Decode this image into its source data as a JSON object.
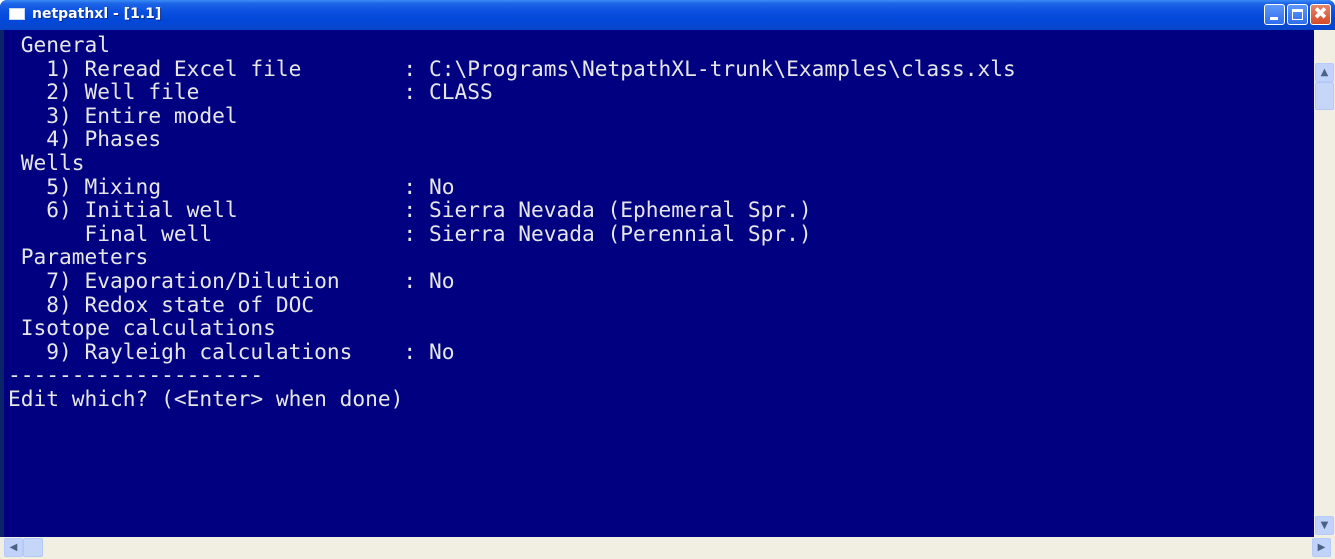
{
  "window": {
    "title": "netpathxl - [1.1]",
    "buttons": {
      "minimize": "minimize",
      "maximize": "maximize",
      "close": "✖"
    }
  },
  "console": {
    "lines": [
      " General",
      "   1) Reread Excel file        : C:\\Programs\\NetpathXL-trunk\\Examples\\class.xls",
      "   2) Well file                : CLASS",
      "   3) Entire model",
      "   4) Phases",
      " Wells",
      "   5) Mixing                   : No",
      "   6) Initial well             : Sierra Nevada (Ephemeral Spr.)",
      "      Final well               : Sierra Nevada (Perennial Spr.)",
      " Parameters",
      "   7) Evaporation/Dilution     : No",
      "   8) Redox state of DOC",
      " Isotope calculations",
      "   9) Rayleigh calculations    : No",
      "--------------------",
      "Edit which? (<Enter> when done)"
    ]
  },
  "scrollbars": {
    "up": "▲",
    "down": "▼",
    "left": "◀",
    "right": "▶"
  },
  "colors": {
    "console_bg": "#000080",
    "console_text": "#e6e6e6",
    "titlebar": "#0148d9"
  }
}
